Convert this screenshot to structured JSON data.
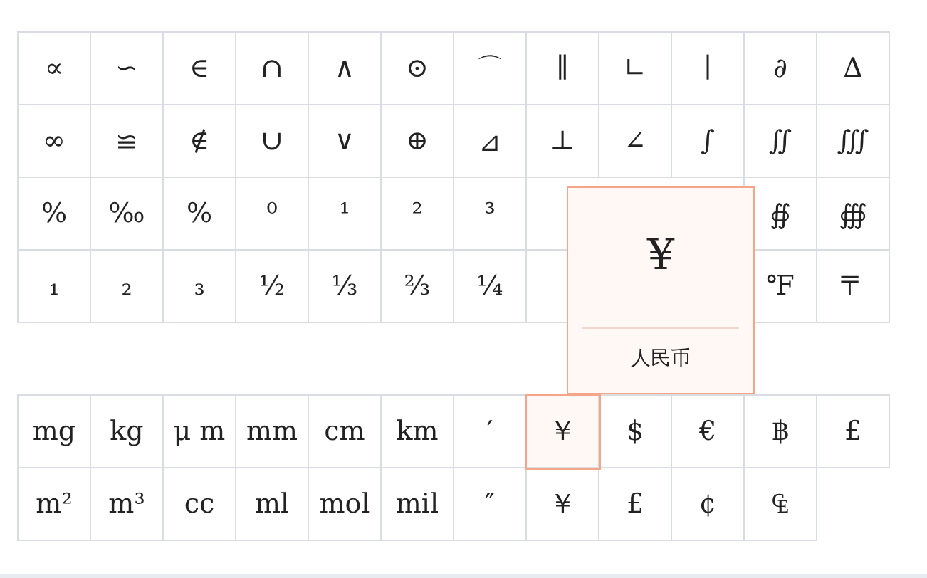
{
  "symbol_grid": [
    [
      {
        "kind": "key",
        "symbol": "∝",
        "selected": false
      },
      {
        "kind": "key",
        "symbol": "∽",
        "selected": false
      },
      {
        "kind": "key",
        "symbol": "∈",
        "selected": false
      },
      {
        "kind": "key",
        "symbol": "∩",
        "selected": false
      },
      {
        "kind": "key",
        "symbol": "∧",
        "selected": false
      },
      {
        "kind": "key",
        "symbol": "⊙",
        "selected": false
      },
      {
        "kind": "key",
        "symbol": "⌒",
        "selected": false
      },
      {
        "kind": "key",
        "symbol": "∥",
        "selected": false
      },
      {
        "kind": "key",
        "symbol": "∟",
        "selected": false
      },
      {
        "kind": "key",
        "symbol": "∣",
        "selected": false
      },
      {
        "kind": "key",
        "symbol": "∂",
        "selected": false
      },
      {
        "kind": "key",
        "symbol": "Δ",
        "selected": false
      }
    ],
    [
      {
        "kind": "key",
        "symbol": "∞",
        "selected": false
      },
      {
        "kind": "key",
        "symbol": "≌",
        "selected": false
      },
      {
        "kind": "key",
        "symbol": "∉",
        "selected": false
      },
      {
        "kind": "key",
        "symbol": "∪",
        "selected": false
      },
      {
        "kind": "key",
        "symbol": "∨",
        "selected": false
      },
      {
        "kind": "key",
        "symbol": "⊕",
        "selected": false
      },
      {
        "kind": "key",
        "symbol": "⊿",
        "selected": false
      },
      {
        "kind": "key",
        "symbol": "⊥",
        "selected": false
      },
      {
        "kind": "key",
        "symbol": "∠",
        "selected": false
      },
      {
        "kind": "key",
        "symbol": "∫",
        "selected": false
      },
      {
        "kind": "key",
        "symbol": "∬",
        "selected": false
      },
      {
        "kind": "key",
        "symbol": "∭",
        "selected": false
      }
    ],
    [
      {
        "kind": "key",
        "symbol": "%",
        "selected": false
      },
      {
        "kind": "key",
        "symbol": "‰",
        "selected": false
      },
      {
        "kind": "key",
        "symbol": "%",
        "selected": false
      },
      {
        "kind": "key",
        "symbol": "⁰",
        "selected": false
      },
      {
        "kind": "key",
        "symbol": "¹",
        "selected": false
      },
      {
        "kind": "key",
        "symbol": "²",
        "selected": false
      },
      {
        "kind": "key",
        "symbol": "³",
        "selected": false
      },
      {
        "kind": "covered"
      },
      {
        "kind": "key",
        "symbol": "∯",
        "selected": false
      },
      {
        "kind": "key",
        "symbol": "∰",
        "selected": false
      }
    ],
    [
      {
        "kind": "key",
        "symbol": "₁",
        "selected": false
      },
      {
        "kind": "key",
        "symbol": "₂",
        "selected": false
      },
      {
        "kind": "key",
        "symbol": "₃",
        "selected": false
      },
      {
        "kind": "key",
        "symbol": "½",
        "selected": false
      },
      {
        "kind": "key",
        "symbol": "⅓",
        "selected": false
      },
      {
        "kind": "key",
        "symbol": "⅔",
        "selected": false
      },
      {
        "kind": "key",
        "symbol": "¼",
        "selected": false
      },
      {
        "kind": "covered"
      },
      {
        "kind": "key",
        "symbol": "℉",
        "selected": false
      },
      {
        "kind": "key",
        "symbol": "〒",
        "selected": false
      }
    ]
  ],
  "unit_grid": [
    [
      {
        "kind": "key",
        "symbol": "mg",
        "selected": false
      },
      {
        "kind": "key",
        "symbol": "kg",
        "selected": false
      },
      {
        "kind": "key",
        "symbol": "μ m",
        "selected": false
      },
      {
        "kind": "key",
        "symbol": "mm",
        "selected": false
      },
      {
        "kind": "key",
        "symbol": "cm",
        "selected": false
      },
      {
        "kind": "key",
        "symbol": "km",
        "selected": false
      },
      {
        "kind": "key",
        "symbol": "′",
        "selected": false
      },
      {
        "kind": "key",
        "symbol": "￥",
        "selected": true
      },
      {
        "kind": "key",
        "symbol": "$",
        "selected": false
      },
      {
        "kind": "key",
        "symbol": "€",
        "selected": false
      },
      {
        "kind": "key",
        "symbol": "฿",
        "selected": false
      },
      {
        "kind": "key",
        "symbol": "£",
        "selected": false
      }
    ],
    [
      {
        "kind": "key",
        "symbol": "m²",
        "selected": false
      },
      {
        "kind": "key",
        "symbol": "m³",
        "selected": false
      },
      {
        "kind": "key",
        "symbol": "cc",
        "selected": false
      },
      {
        "kind": "key",
        "symbol": "ml",
        "selected": false
      },
      {
        "kind": "key",
        "symbol": "mol",
        "selected": false
      },
      {
        "kind": "key",
        "symbol": "mil",
        "selected": false
      },
      {
        "kind": "key",
        "symbol": "″",
        "selected": false
      },
      {
        "kind": "key",
        "symbol": "￥",
        "selected": false
      },
      {
        "kind": "key",
        "symbol": "£",
        "selected": false
      },
      {
        "kind": "key",
        "symbol": "¢",
        "selected": false
      },
      {
        "kind": "key",
        "symbol": "₠",
        "selected": false
      }
    ]
  ],
  "tooltip": {
    "symbol": "¥",
    "name": "人民币"
  }
}
